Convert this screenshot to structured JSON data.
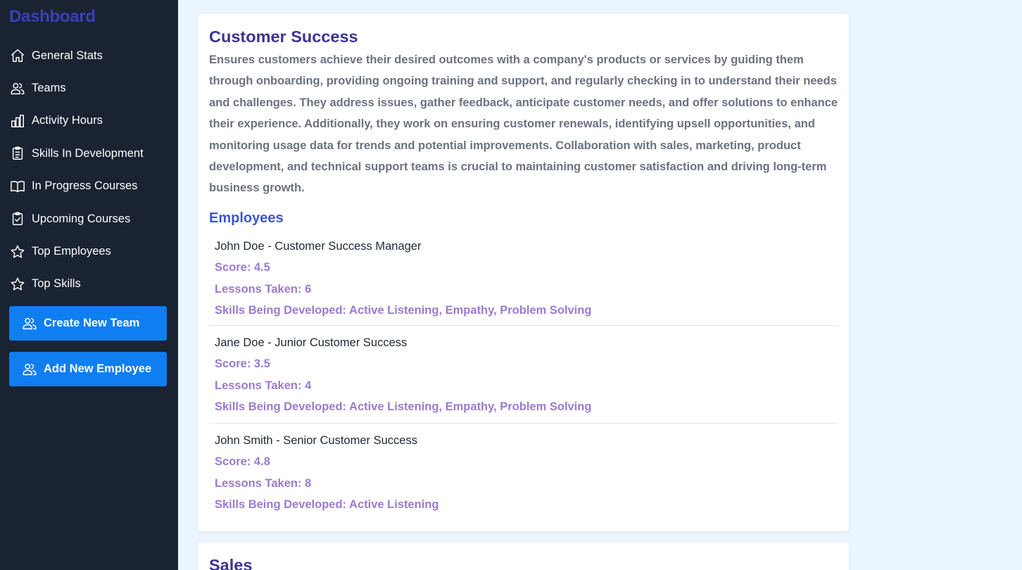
{
  "sidebar": {
    "brand": "Dashboard",
    "items": [
      {
        "label": "General Stats",
        "icon": "home-icon"
      },
      {
        "label": "Teams",
        "icon": "users-icon"
      },
      {
        "label": "Activity Hours",
        "icon": "bar-chart-icon"
      },
      {
        "label": "Skills In Development",
        "icon": "clipboard-list-icon"
      },
      {
        "label": "In Progress Courses",
        "icon": "book-open-icon"
      },
      {
        "label": "Upcoming Courses",
        "icon": "clipboard-check-icon"
      },
      {
        "label": "Top Employees",
        "icon": "star-icon"
      },
      {
        "label": "Top Skills",
        "icon": "star-icon"
      }
    ],
    "create_team_label": "Create New Team",
    "add_employee_label": "Add New Employee"
  },
  "team": {
    "title": "Customer Success",
    "description": "Ensures customers achieve their desired outcomes with a company's products or services by guiding them through onboarding, providing ongoing training and support, and regularly checking in to understand their needs and challenges. They address issues, gather feedback, anticipate customer needs, and offer solutions to enhance their experience. Additionally, they work on ensuring customer renewals, identifying upsell opportunities, and monitoring usage data for trends and potential improvements. Collaboration with sales, marketing, product development, and technical support teams is crucial to maintaining customer satisfaction and driving long-term business growth.",
    "employees_heading": "Employees",
    "employees": [
      {
        "name": "John Doe - Customer Success Manager",
        "score": "Score: 4.5",
        "lessons": "Lessons Taken: 6",
        "skills": "Skills Being Developed: Active Listening, Empathy, Problem Solving"
      },
      {
        "name": "Jane Doe - Junior Customer Success",
        "score": "Score: 3.5",
        "lessons": "Lessons Taken: 4",
        "skills": "Skills Being Developed: Active Listening, Empathy, Problem Solving"
      },
      {
        "name": "John Smith - Senior Customer Success",
        "score": "Score: 4.8",
        "lessons": "Lessons Taken: 8",
        "skills": "Skills Being Developed: Active Listening"
      }
    ]
  },
  "next_team": {
    "title": "Sales"
  },
  "colors": {
    "sidebar_bg": "#1a2332",
    "brand": "#3b40b8",
    "button": "#0f7ef0",
    "page_bg": "#ebf5ff",
    "team_title": "#3b3493",
    "employees_heading": "#3d55d6",
    "employee_detail": "#9a7bd0"
  }
}
